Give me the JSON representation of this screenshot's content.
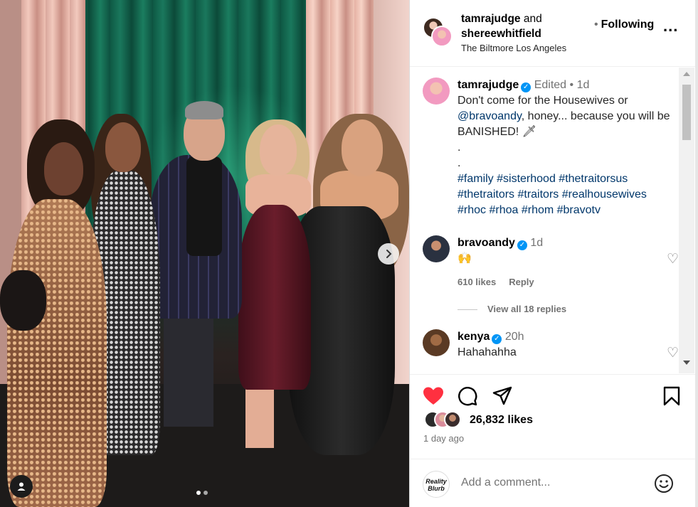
{
  "post_header": {
    "user1": "tamrajudge",
    "and": "and",
    "user2": "shereewhitfield",
    "separator": "•",
    "following": "Following",
    "location": "The Biltmore Los Angeles",
    "more": "..."
  },
  "caption": {
    "username": "tamrajudge",
    "edited": "Edited",
    "dot": "•",
    "time": "1d",
    "text1": "Don't come for the Housewives or ",
    "mention": "@bravoandy",
    "text2": ", honey... because you will be BANISHED! 🗡",
    "dot1": ".",
    "dot2": ".",
    "hashtags": "#family #sisterhood #thetraitorsus #thetraitors #traitors #realhousewives #rhoc #rhoa #rhom #bravotv"
  },
  "comments": [
    {
      "username": "bravoandy",
      "time": "1d",
      "text": "🙌",
      "likes": "610 likes",
      "reply": "Reply",
      "view_replies": "View all 18 replies"
    },
    {
      "username": "kenya",
      "time": "20h",
      "text": "Hahahahha"
    }
  ],
  "post": {
    "likes": "26,832 likes",
    "time": "1 day ago",
    "slide_index": 1,
    "slide_count": 2
  },
  "add_comment": {
    "avatar_text_1": "Reality",
    "avatar_text_2": "Blurb",
    "placeholder": "Add a comment..."
  },
  "icons": {
    "like": "heart-filled-icon",
    "comment": "comment-icon",
    "share": "share-icon",
    "save": "bookmark-icon",
    "emoji": "emoji-icon",
    "next": "chevron-right-icon",
    "tag": "user-icon"
  },
  "colors": {
    "like": "#ff3040",
    "verified": "#0095f6",
    "hashtag": "#00376b",
    "secondary_text": "#737373"
  }
}
